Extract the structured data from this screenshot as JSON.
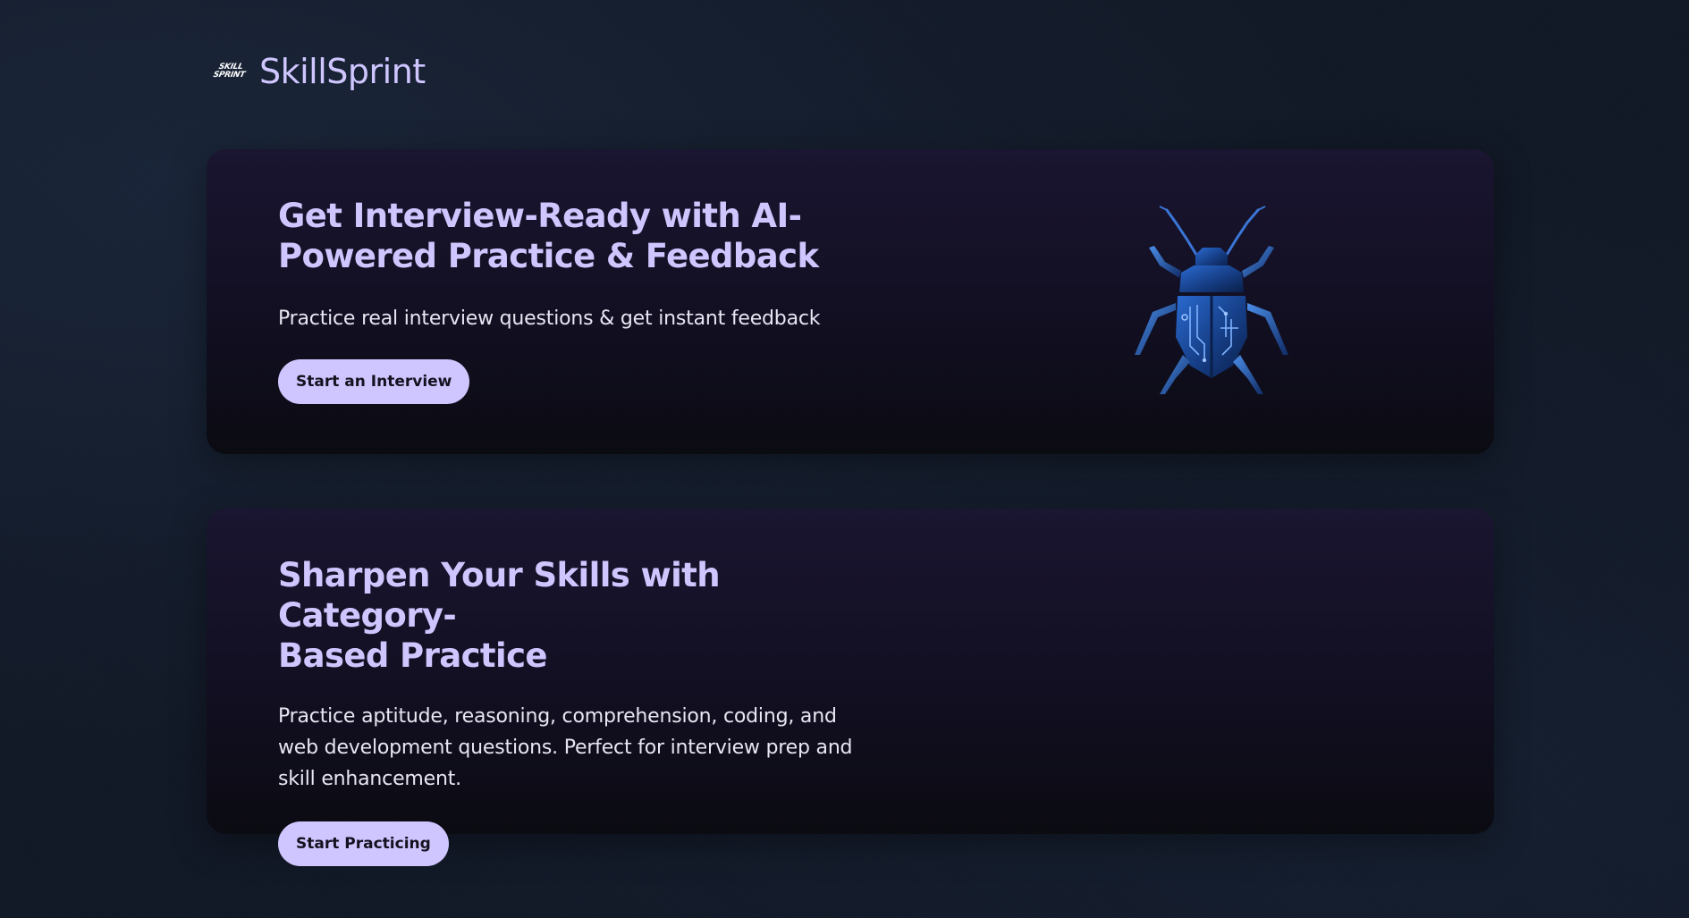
{
  "brand": {
    "logo_line1": "SKILL",
    "logo_line2": "SPRINT",
    "name": "SkillSprint"
  },
  "cards": [
    {
      "title_line1": "Get Interview-Ready with AI-",
      "title_line2": "Powered Practice & Feedback",
      "description": "Practice real interview questions & get instant feedback",
      "button_label": "Start an Interview",
      "illustration": "circuit-beetle-icon"
    },
    {
      "title_line1": "Sharpen Your Skills with Category-",
      "title_line2": "Based Practice",
      "description_line1": "Practice aptitude, reasoning, comprehension, coding, and",
      "description_line2": "web development questions. Perfect for interview prep and",
      "description_line3": "skill enhancement.",
      "button_label": "Start Practicing"
    }
  ],
  "colors": {
    "accent": "#cfc6ff",
    "background": "#111826",
    "card_top": "#1a1530",
    "card_bottom": "#0b0b12",
    "beetle_blue": "#1d4fa8"
  }
}
